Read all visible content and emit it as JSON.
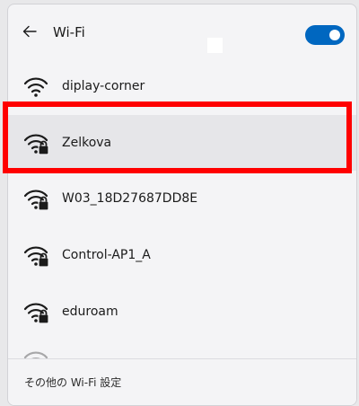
{
  "header": {
    "title": "Wi-Fi",
    "back_icon": "arrow-left-icon",
    "wifi_enabled": true,
    "accent_color": "#0067c0"
  },
  "networks": [
    {
      "name": "diplay-corner",
      "secured": false,
      "icon": "wifi-signal-icon"
    },
    {
      "name": "Zelkova",
      "secured": true,
      "icon": "wifi-secured-icon",
      "highlighted": true
    },
    {
      "name": "W03_18D27687DD8E",
      "secured": true,
      "icon": "wifi-secured-icon"
    },
    {
      "name": "Control-AP1_A",
      "secured": true,
      "icon": "wifi-secured-icon"
    },
    {
      "name": "eduroam",
      "secured": true,
      "icon": "wifi-secured-icon"
    }
  ],
  "footer": {
    "link_label": "その他の Wi-Fi 設定"
  },
  "highlight_color": "#ff0000"
}
